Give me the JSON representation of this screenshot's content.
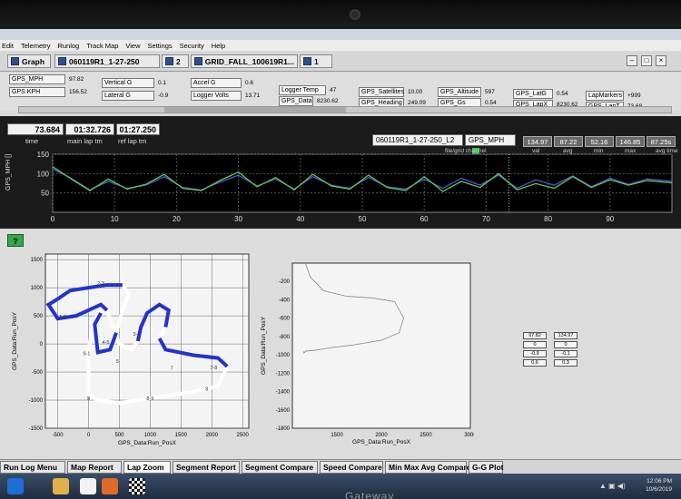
{
  "menu": [
    "Edit",
    "Telemetry",
    "Runlog",
    "Track Map",
    "View",
    "Settings",
    "Security",
    "Help"
  ],
  "tabs": {
    "graph": "Graph",
    "run": "060119R1_1-27-250",
    "count": "2",
    "file": "GRID_FALL_100619R1...",
    "index": "1"
  },
  "gauges": [
    {
      "label": "GPS_MPH",
      "value": "97.82"
    },
    {
      "label": "GPS KPH",
      "value": "156.52"
    },
    {
      "label": "Vertical G",
      "value": "0.1"
    },
    {
      "label": "Lateral G",
      "value": "-0.9"
    },
    {
      "label": "Accel G",
      "value": "0.6"
    },
    {
      "label": "Logger Volts",
      "value": "13.71"
    },
    {
      "label": "Logger Temp",
      "value": "47"
    },
    {
      "label": "GPS_Data",
      "value": "8230.62"
    },
    {
      "label": "GPS_Satellites",
      "value": "10.00"
    },
    {
      "label": "GPS_Heading",
      "value": "249.09"
    },
    {
      "label": "GPS_Altitude",
      "value": "597"
    },
    {
      "label": "GPS_Gs",
      "value": "0.54"
    },
    {
      "label": "GPS_LatG",
      "value": "0.54"
    },
    {
      "label": "GPS_LapX",
      "value": "8230.62"
    },
    {
      "label": "LapMarkers",
      "value": "+999"
    },
    {
      "label": "GPS_LapT",
      "value": "73.68"
    }
  ],
  "readouts": {
    "time": "73.684",
    "time_cap": "time",
    "main_lap": "01:32.726",
    "main_lap_cap": "main lap tm",
    "ref_lap": "01:27.250",
    "ref_lap_cap": "ref lap tm",
    "channel_file": "060119R1_1-27-250_L2",
    "channel_name": "GPS_MPH",
    "channel_cap": "file/grid channel",
    "stats": [
      {
        "value": "134.97",
        "cap": "val"
      },
      {
        "value": "87.22",
        "cap": "avg"
      },
      {
        "value": "52.16",
        "cap": "min"
      },
      {
        "value": "146.85",
        "cap": "max"
      },
      {
        "value": "87.25s",
        "cap": "avg time"
      }
    ]
  },
  "help_label": "?",
  "mini_table": [
    [
      "97.82",
      "134.97"
    ],
    [
      "0",
      "0"
    ],
    [
      "-0.9",
      "-0.1"
    ],
    [
      "0.6",
      "0.3"
    ]
  ],
  "bottom_tabs": [
    "Run Log Menu",
    "Map Report",
    "Lap Zoom",
    "Segment Report",
    "Segment Compare",
    "Speed Compare",
    "Min Max Avg Compare",
    "G-G Plot"
  ],
  "clock": {
    "time": "12:06 PM",
    "date": "10/6/2019"
  },
  "brand": "Gateway",
  "chart_data": [
    {
      "type": "line",
      "ylabel": "GPS_MPH []",
      "xlim": [
        0,
        100
      ],
      "ylim": [
        0,
        150
      ],
      "xticks": [
        0,
        10,
        20,
        30,
        40,
        50,
        60,
        70,
        80,
        90
      ],
      "yticks": [
        50,
        100,
        150
      ],
      "cursor_x": 73.684,
      "series": [
        {
          "color": "#4a5bd6",
          "x": [
            0,
            3,
            6,
            9,
            12,
            15,
            18,
            21,
            24,
            27,
            30,
            33,
            36,
            39,
            42,
            45,
            48,
            51,
            54,
            57,
            60,
            63,
            66,
            69,
            72,
            75,
            78,
            81,
            84,
            87,
            90,
            93,
            96,
            100
          ],
          "values": [
            112,
            88,
            58,
            80,
            62,
            70,
            92,
            64,
            58,
            78,
            96,
            68,
            86,
            60,
            92,
            70,
            62,
            90,
            66,
            60,
            86,
            62,
            88,
            70,
            96,
            62,
            84,
            70,
            94,
            66,
            88,
            72,
            86,
            80
          ]
        },
        {
          "color": "#5fc452",
          "x": [
            0,
            3,
            6,
            9,
            12,
            15,
            18,
            21,
            24,
            27,
            30,
            33,
            36,
            39,
            42,
            45,
            48,
            51,
            54,
            57,
            60,
            63,
            66,
            69,
            72,
            75,
            78,
            81,
            84,
            87,
            90,
            93,
            96,
            100
          ],
          "values": [
            118,
            86,
            56,
            86,
            60,
            72,
            98,
            62,
            56,
            82,
            104,
            66,
            90,
            58,
            98,
            68,
            60,
            96,
            64,
            56,
            92,
            54,
            80,
            64,
            100,
            58,
            74,
            62,
            92,
            64,
            84,
            70,
            82,
            76
          ]
        }
      ]
    },
    {
      "type": "scatter",
      "xlabel": "GPS_Data:Run_PosX",
      "ylabel": "GPS_Data:Run_PosY",
      "xlim": [
        -700,
        2600
      ],
      "ylim": [
        -1500,
        1600
      ],
      "xticks": [
        -500,
        0,
        500,
        1000,
        1500,
        2000,
        2500
      ],
      "yticks": [
        -1500,
        -1000,
        -500,
        0,
        500,
        1000,
        1500
      ],
      "track": [
        [
          -500,
          800
        ],
        [
          -300,
          950
        ],
        [
          0,
          1000
        ],
        [
          300,
          1050
        ],
        [
          550,
          1050
        ],
        [
          650,
          900
        ],
        [
          550,
          600
        ],
        [
          500,
          400
        ],
        [
          450,
          200
        ],
        [
          350,
          -100
        ],
        [
          150,
          -150
        ],
        [
          100,
          350
        ],
        [
          200,
          550
        ],
        [
          100,
          450
        ],
        [
          0,
          -100
        ],
        [
          0,
          -500
        ],
        [
          0,
          -900
        ],
        [
          150,
          -1000
        ],
        [
          500,
          -1050
        ],
        [
          1100,
          -950
        ],
        [
          1700,
          -850
        ],
        [
          2100,
          -750
        ],
        [
          2250,
          -400
        ],
        [
          2100,
          -250
        ],
        [
          1700,
          -200
        ],
        [
          1250,
          -100
        ],
        [
          1150,
          100
        ],
        [
          1250,
          300
        ],
        [
          1300,
          600
        ],
        [
          1150,
          700
        ],
        [
          950,
          550
        ],
        [
          850,
          300
        ],
        [
          800,
          50
        ],
        [
          700,
          -100
        ],
        [
          500,
          0
        ],
        [
          400,
          300
        ],
        [
          300,
          600
        ],
        [
          200,
          700
        ],
        [
          -200,
          500
        ],
        [
          -500,
          450
        ],
        [
          -650,
          700
        ],
        [
          -500,
          800
        ]
      ],
      "segment_labels": [
        {
          "text": "1-2",
          "x": -420,
          "y": 450
        },
        {
          "text": "2-3",
          "x": 200,
          "y": 1050
        },
        {
          "text": "3-4",
          "x": 780,
          "y": 150
        },
        {
          "text": "4-5",
          "x": 280,
          "y": 0
        },
        {
          "text": "5",
          "x": 470,
          "y": -340
        },
        {
          "text": "7",
          "x": 1350,
          "y": -460
        },
        {
          "text": "7-8",
          "x": 2030,
          "y": -450
        },
        {
          "text": "8",
          "x": 1920,
          "y": -830
        },
        {
          "text": "8-9",
          "x": 1000,
          "y": -1000
        },
        {
          "text": "9",
          "x": 0,
          "y": -1000
        },
        {
          "text": "9-1",
          "x": -30,
          "y": -200
        }
      ]
    },
    {
      "type": "line",
      "xlabel": "GPS_Data:Run_PosX",
      "ylabel": "GPS_Data:Run_PosY",
      "xlim": [
        1000,
        3000
      ],
      "ylim": [
        -1800,
        0
      ],
      "xticks": [
        1500,
        2000,
        2500,
        3000
      ],
      "yticks": [
        -200,
        -400,
        -600,
        -800,
        -1000,
        -1200,
        -1400,
        -1600,
        -1800
      ],
      "x": [
        1150,
        1200,
        1350,
        1600,
        1900,
        2150,
        2250,
        2200,
        2000,
        1700,
        1450,
        1250,
        1150,
        1130,
        1130
      ],
      "values": [
        -10,
        -150,
        -300,
        -360,
        -380,
        -420,
        -600,
        -760,
        -840,
        -890,
        -920,
        -950,
        -960,
        -980,
        -960
      ]
    }
  ]
}
